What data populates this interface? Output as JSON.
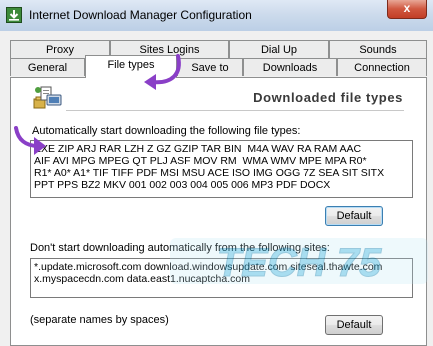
{
  "window": {
    "title": "Internet Download Manager Configuration",
    "close_glyph": "x"
  },
  "tabs": {
    "row1": [
      "Proxy",
      "Sites Logins",
      "Dial Up",
      "Sounds"
    ],
    "row2": [
      "General",
      "File types",
      "Save to",
      "Downloads",
      "Connection"
    ],
    "active": "File types"
  },
  "panel": {
    "heading": "Downloaded file types",
    "auto_label": "Automatically start downloading the following file types:",
    "file_types": "EXE ZIP ARJ RAR LZH Z GZ GZIP TAR BIN  M4A WAV RA RAM AAC\nAIF AVI MPG MPEG QT PLJ ASF MOV RM  WMA WMV MPE MPA R0*\nR1* A0* A1* TIF TIFF PDF MSI MSU ACE ISO IMG OGG 7Z SEA SIT SITX\nPPT PPS BZ2 MKV 001 002 003 004 005 006 MP3 PDF DOCX",
    "default_button_1": "Default",
    "sites_label": "Don't start downloading automatically from the following sites:",
    "sites": "*.update.microsoft.com download.windowsupdate.com siteseal.thawte.com\nx.myspacecdn.com data.east1.nucaptcha.com",
    "separator_note": "(separate names by spaces)",
    "default_button_2": "Default"
  },
  "watermark": {
    "text": "TECH 75"
  },
  "colors": {
    "annotation_arrow": "#8a3fc7",
    "focus_border": "#3c7fb1",
    "titlebar": "#cddbec"
  }
}
